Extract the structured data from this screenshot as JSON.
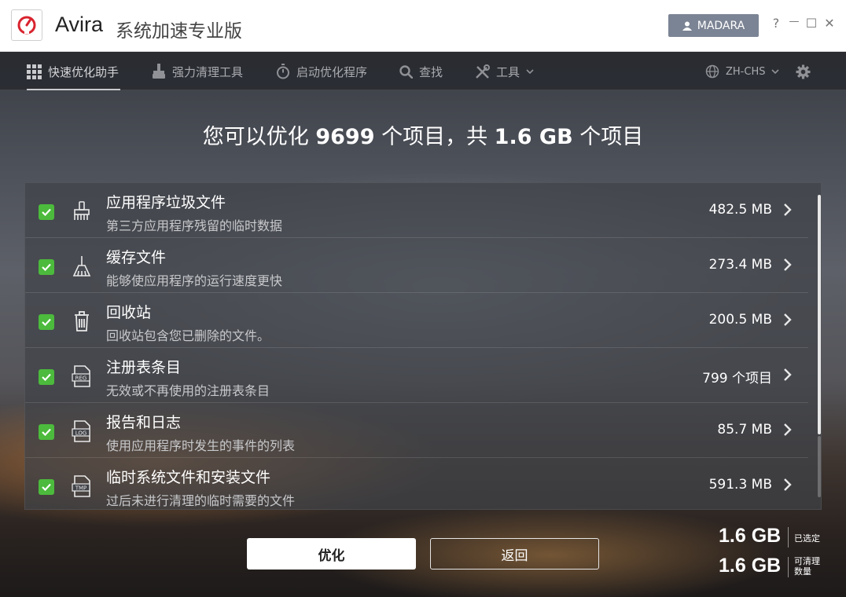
{
  "app": {
    "name": "Avira",
    "subtitle": "系统加速专业版",
    "user_button": "MADARA",
    "window_controls": {
      "help": "?",
      "minimize": "—",
      "maximize": "☐",
      "close": "✕"
    }
  },
  "nav": {
    "items": [
      {
        "label": "快速优化助手",
        "icon": "grid-icon"
      },
      {
        "label": "强力清理工具",
        "icon": "vacuum-icon"
      },
      {
        "label": "启动优化程序",
        "icon": "stopwatch-icon"
      },
      {
        "label": "查找",
        "icon": "search-icon"
      },
      {
        "label": "工具",
        "icon": "tools-icon"
      }
    ],
    "language": "ZH-CHS"
  },
  "headline": {
    "prefix": "您可以优化 ",
    "count": "9699",
    "middle": " 个项目，共 ",
    "size": "1.6 GB",
    "suffix": " 个项目"
  },
  "items": [
    {
      "title": "应用程序垃圾文件",
      "desc": "第三方应用程序残留的临时数据",
      "size": "482.5 MB",
      "icon": "brush-icon",
      "checked": true
    },
    {
      "title": "缓存文件",
      "desc": "能够使应用程序的运行速度更快",
      "size": "273.4 MB",
      "icon": "broom-icon",
      "checked": true
    },
    {
      "title": "回收站",
      "desc": "回收站包含您已删除的文件。",
      "size": "200.5 MB",
      "icon": "trash-icon",
      "checked": true
    },
    {
      "title": "注册表条目",
      "desc": "无效或不再使用的注册表条目",
      "size": "799 个项目",
      "icon": "reg-file-icon",
      "icon_text": "REG",
      "checked": true
    },
    {
      "title": "报告和日志",
      "desc": "使用应用程序时发生的事件的列表",
      "size": "85.7 MB",
      "icon": "log-file-icon",
      "icon_text": "LOG",
      "checked": true
    },
    {
      "title": "临时系统文件和安装文件",
      "desc": "过后未进行清理的临时需要的文件",
      "size": "591.3 MB",
      "icon": "tmp-file-icon",
      "icon_text": "TMP",
      "checked": true
    }
  ],
  "buttons": {
    "optimize": "优化",
    "back": "返回"
  },
  "summary": {
    "selected_value": "1.6 GB",
    "selected_label": "已选定",
    "cleanable_value": "1.6 GB",
    "cleanable_label": "可清理数量"
  },
  "colors": {
    "accent_red": "#d9232e",
    "check_green": "#4cba3c",
    "user_button": "#7b8494"
  }
}
